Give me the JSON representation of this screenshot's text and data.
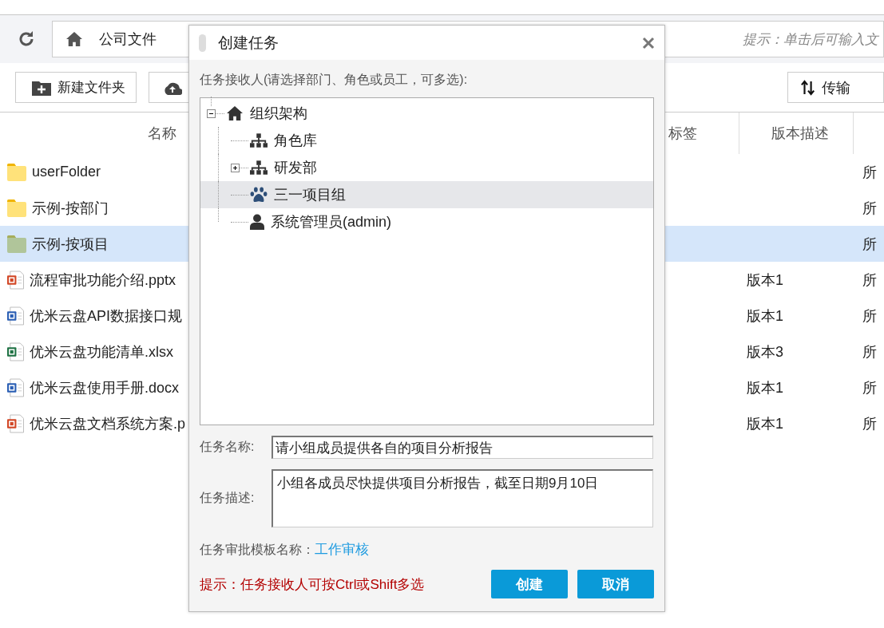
{
  "address_bar": {
    "path": "公司文件",
    "hint": "提示：单击后可输入文"
  },
  "toolbar": {
    "buttons": [
      {
        "kind": "new-folder",
        "label": "新建文件夹"
      },
      {
        "kind": "upload"
      },
      {
        "kind": "transfer",
        "label": "传输"
      }
    ]
  },
  "table": {
    "columns": [
      "名称",
      "标签",
      "版本描述"
    ],
    "rows": [
      {
        "kind": "folder",
        "name": "userFolder",
        "column_5": "所",
        "selected": false
      },
      {
        "kind": "folder",
        "name": "示例-按部门",
        "column_5": "所",
        "selected": false
      },
      {
        "kind": "folder",
        "name": "示例-按项目",
        "column_5": "所",
        "selected": true
      },
      {
        "kind": "slides",
        "name": "流程审批功能介绍.pptx",
        "version": "版本1",
        "column_5": "所",
        "selected": false
      },
      {
        "kind": "document",
        "name": "优米云盘API数据接口规",
        "version": "版本1",
        "column_5": "所",
        "selected": false
      },
      {
        "kind": "spreadsheet",
        "name": "优米云盘功能清单.xlsx",
        "version": "版本3",
        "column_5": "所",
        "selected": false
      },
      {
        "kind": "document",
        "name": "优米云盘使用手册.docx",
        "version": "版本1",
        "column_5": "所",
        "selected": false
      },
      {
        "kind": "slides",
        "name": "优米云盘文档系统方案.p",
        "version": "版本1",
        "column_5": "所",
        "selected": false
      }
    ]
  },
  "dialog": {
    "title": "创建任务",
    "recipients_label": "任务接收人(请选择部门、角色或员工，可多选):",
    "tree": [
      {
        "label": "组织架构",
        "kind": "home",
        "expanded": true,
        "selected": false,
        "children": [
          {
            "label": "角色库",
            "kind": "role",
            "selected": false
          },
          {
            "label": "研发部",
            "kind": "department",
            "expanded": false,
            "selected": false
          },
          {
            "label": "三一项目组",
            "kind": "group",
            "selected": true
          },
          {
            "label": "系统管理员(admin)",
            "kind": "user",
            "selected": false
          }
        ]
      }
    ],
    "task_name": {
      "label": "任务名称:",
      "value": "请小组成员提供各自的项目分析报告"
    },
    "task_description": {
      "label": "任务描述:",
      "value": "小组各成员尽快提供项目分析报告，截至日期9月10日"
    },
    "template": {
      "label": "任务审批模板名称：",
      "link": "工作审核"
    },
    "hint": "提示：任务接收人可按Ctrl或Shift多选",
    "buttons": [
      "创建",
      "取消"
    ]
  }
}
